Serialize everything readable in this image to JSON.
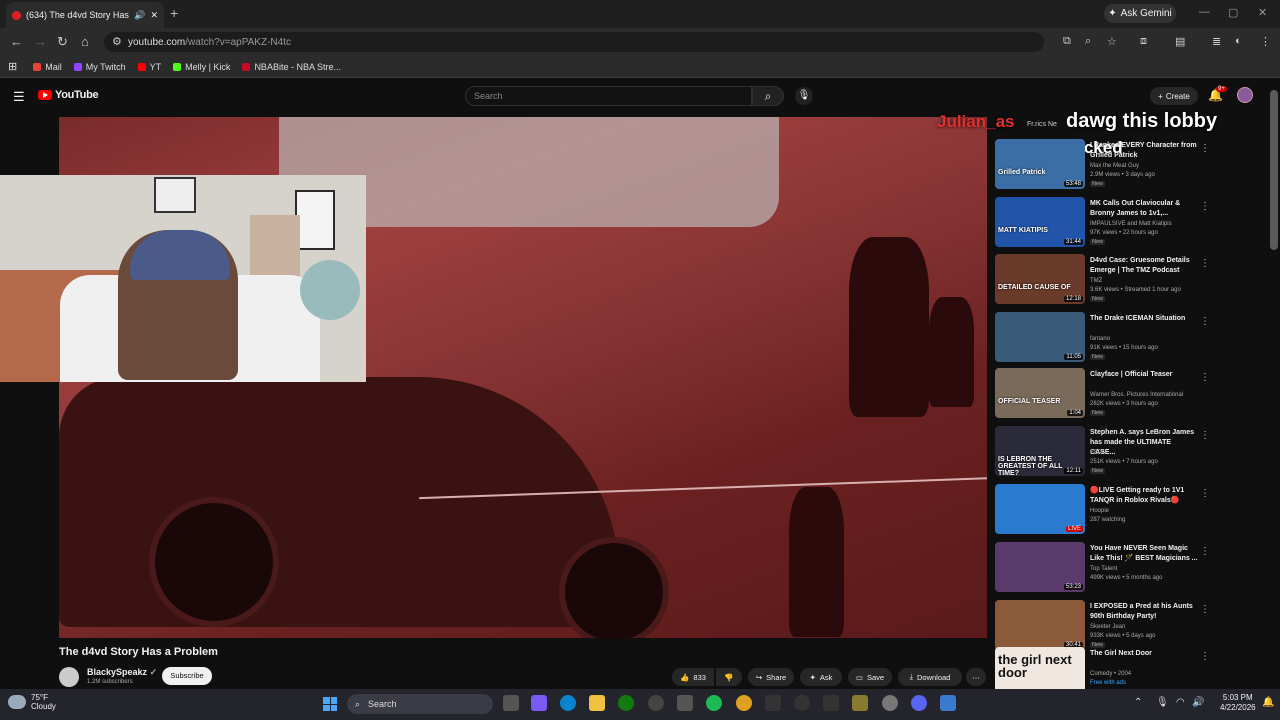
{
  "browser": {
    "tab_title": "(634) The d4vd Story Has a",
    "new_tab": "+",
    "ask_gemini": "Ask Gemini",
    "url_domain": "youtube.com",
    "url_path": "/watch?v=apPAKZ-N4tc",
    "bookmarks": [
      {
        "label": "Mail",
        "color": "#ea4335"
      },
      {
        "label": "My Twitch",
        "color": "#9146ff"
      },
      {
        "label": "YT",
        "color": "#ff0000"
      },
      {
        "label": "Melly | Kick",
        "color": "#53fc18"
      },
      {
        "label": "NBABite - NBA Stre...",
        "color": "#c9082a"
      }
    ]
  },
  "youtube": {
    "logo": "YouTube",
    "search_placeholder": "Search",
    "create_label": "Create",
    "notif_count": "9+"
  },
  "overlay": {
    "username": "Julian_as",
    "chat_line1": "dawg this lobby",
    "chat_line2": "packed",
    "chapter": "Fr.rics Ne"
  },
  "video": {
    "title": "The d4vd Story Has a Problem",
    "channel": "BlackySpeakz",
    "subscribers": "1.2M subscribers",
    "subscribe": "Subscribe",
    "likes": "833",
    "share": "Share",
    "ask": "Ask",
    "save": "Save",
    "download": "Download"
  },
  "recommendations": [
    {
      "title": "I Ranked EVERY Character from Grilled Patrick",
      "channel": "Max the Meat Guy",
      "meta": "2.9M views • 3 days ago",
      "badge": "New",
      "duration": "53:48",
      "thumb_text": "Grilled Patrick",
      "thumb_color": "#3a6ea5"
    },
    {
      "title": "MK Calls Out Claviocular & Bronny James to 1v1,...",
      "channel": "IMPAULSIVE and Matt Kiatipis",
      "meta": "97K views • 22 hours ago",
      "badge": "New",
      "duration": "31:44",
      "thumb_text": "MATT KIATIPIS",
      "thumb_color": "#2255aa"
    },
    {
      "title": "D4vd Case: Gruesome Details Emerge | The TMZ Podcast",
      "channel": "TMZ",
      "meta": "3.6K views • Streamed 1 hour ago",
      "badge": "New",
      "duration": "12:18",
      "thumb_text": "DETAILED CAUSE OF",
      "thumb_color": "#6a3a2a"
    },
    {
      "title": "The Drake ICEMAN Situation",
      "channel": "fantano",
      "meta": "91K views • 15 hours ago",
      "badge": "New",
      "duration": "11:05",
      "thumb_text": "",
      "thumb_color": "#3a5a7a"
    },
    {
      "title": "Clayface | Official Teaser",
      "channel": "Warner Bros. Pictures International",
      "meta": "282K views • 3 hours ago",
      "badge": "New",
      "duration": "1:04",
      "thumb_text": "OFFICIAL TEASER",
      "thumb_color": "#7a6a5a"
    },
    {
      "title": "Stephen A. says LeBron James has made the ULTIMATE CASE...",
      "channel": "ESPN",
      "meta": "251K views • 7 hours ago",
      "badge": "New",
      "duration": "12:11",
      "thumb_text": "IS LEBRON THE GREATEST OF ALL TIME?",
      "thumb_color": "#2a2a3a"
    },
    {
      "title": "🔴LIVE Getting ready to 1V1 TANQR in Roblox Rivals🔴",
      "channel": "Hoopie",
      "meta": "287 watching",
      "badge": "",
      "duration": "LIVE",
      "thumb_text": "",
      "thumb_color": "#2a7ad0"
    },
    {
      "title": "You Have NEVER Seen Magic Like This! 🪄 BEST Magicians ...",
      "channel": "Top Talent",
      "meta": "499K views • 5 months ago",
      "badge": "",
      "duration": "53:23",
      "thumb_text": "",
      "thumb_color": "#5a3a6a"
    },
    {
      "title": "I EXPOSED a Pred at his Aunts 90th Birthday Party!",
      "channel": "Skeeter Jean",
      "meta": "933K views • 5 days ago",
      "badge": "New",
      "duration": "30:41",
      "thumb_text": "",
      "thumb_color": "#8a5a3a"
    },
    {
      "title": "The Girl Next Door",
      "channel": "Comedy • 2004",
      "meta": "Free with ads",
      "badge": "R",
      "duration": "",
      "thumb_text": "the girl next door",
      "thumb_color": "#f0e8e0"
    }
  ],
  "taskbar": {
    "temp": "75°F",
    "condition": "Cloudy",
    "search": "Search",
    "time": "5:03 PM",
    "date": "4/22/2026"
  }
}
